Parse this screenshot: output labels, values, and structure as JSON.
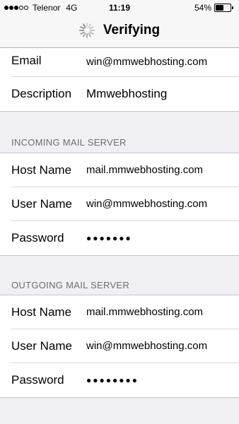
{
  "status_bar": {
    "signal_dots_filled": 3,
    "signal_dots_total": 5,
    "carrier": "Telenor",
    "network": "4G",
    "time": "11:19",
    "battery_percent": "54%",
    "battery_level": 0.54
  },
  "nav": {
    "title": "Verifying",
    "spinner_icon": "activity-spinner-icon"
  },
  "account": {
    "rows": [
      {
        "label": "Email",
        "value": "win@mmwebhosting.com"
      },
      {
        "label": "Description",
        "value": "Mmwebhosting"
      }
    ]
  },
  "incoming": {
    "header": "INCOMING MAIL SERVER",
    "rows": [
      {
        "label": "Host Name",
        "value": "mail.mmwebhosting.com"
      },
      {
        "label": "User Name",
        "value": "win@mmwebhosting.com"
      },
      {
        "label": "Password",
        "value": "●●●●●●●"
      }
    ]
  },
  "outgoing": {
    "header": "OUTGOING MAIL SERVER",
    "rows": [
      {
        "label": "Host Name",
        "value": "mail.mmwebhosting.com"
      },
      {
        "label": "User Name",
        "value": "win@mmwebhosting.com"
      },
      {
        "label": "Password",
        "value": "●●●●●●●●"
      }
    ]
  },
  "colors": {
    "background": "#efeff4",
    "bar": "#f7f7f7",
    "section_header": "#6d6d72",
    "separator": "#d9d9d9"
  }
}
